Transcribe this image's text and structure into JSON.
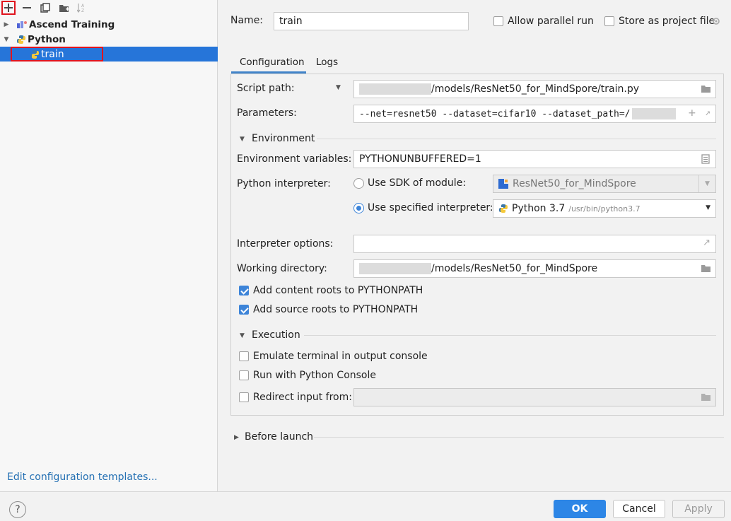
{
  "left": {
    "tree": [
      {
        "label": "Ascend Training",
        "expanded": false
      },
      {
        "label": "Python",
        "expanded": true
      },
      {
        "label": "train",
        "selected": true
      }
    ],
    "edit_templates": "Edit configuration templates..."
  },
  "header": {
    "name_label": "Name:",
    "name_value": "train",
    "allow_parallel": "Allow parallel run",
    "store_project_file": "Store as project file"
  },
  "tabs": [
    "Configuration",
    "Logs"
  ],
  "config": {
    "script_path_label": "Script path:",
    "script_path_value": "/models/ResNet50_for_MindSpore/train.py",
    "parameters_label": "Parameters:",
    "parameters_value": "--net=resnet50 --dataset=cifar10 --dataset_path=/",
    "environment_header": "Environment",
    "env_vars_label": "Environment variables:",
    "env_vars_value": "PYTHONUNBUFFERED=1",
    "interpreter_label": "Python interpreter:",
    "use_sdk_label": "Use SDK of module:",
    "sdk_module_value": "ResNet50_for_MindSpore",
    "use_specified_label": "Use specified interpreter:",
    "interpreter_name": "Python 3.7",
    "interpreter_path": "/usr/bin/python3.7",
    "interp_options_label": "Interpreter options:",
    "working_dir_label": "Working directory:",
    "working_dir_value": "/models/ResNet50_for_MindSpore",
    "add_content_roots": "Add content roots to PYTHONPATH",
    "add_source_roots": "Add source roots to PYTHONPATH",
    "execution_header": "Execution",
    "emulate_terminal": "Emulate terminal in output console",
    "run_python_console": "Run with Python Console",
    "redirect_input": "Redirect input from:"
  },
  "before_launch": "Before launch",
  "footer": {
    "ok": "OK",
    "cancel": "Cancel",
    "apply": "Apply",
    "help": "?"
  },
  "colors": {
    "selection": "#2675d9",
    "primary_button": "#2d86e6",
    "link": "#2470b3",
    "highlight_box": "#e0141e"
  }
}
